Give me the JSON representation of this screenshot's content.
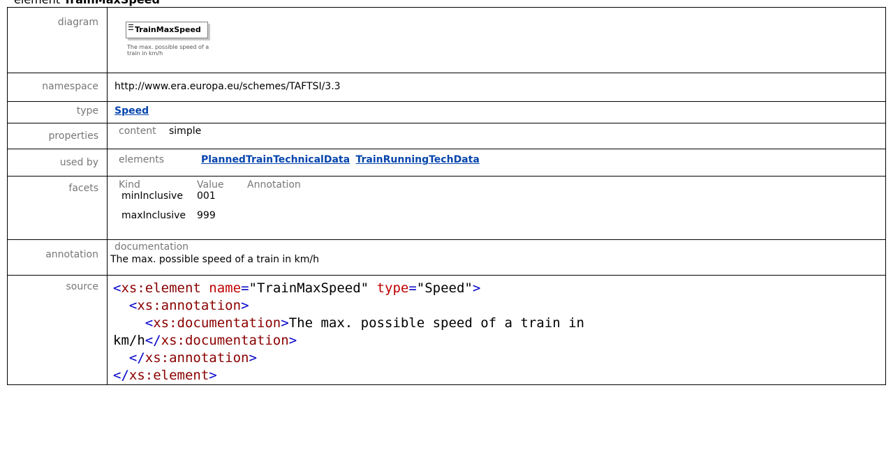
{
  "heading": {
    "keyword": "element",
    "name": "TrainMaxSpeed"
  },
  "rows": {
    "diagram": {
      "label": "diagram",
      "box_name": "TrainMaxSpeed",
      "box_doc": "The max. possible speed of a train in km/h"
    },
    "namespace": {
      "label": "namespace",
      "value": "http://www.era.europa.eu/schemes/TAFTSI/3.3"
    },
    "type": {
      "label": "type",
      "value": "Speed"
    },
    "properties": {
      "label": "properties",
      "key": "content",
      "value": "simple"
    },
    "used_by": {
      "label": "used by",
      "key": "elements",
      "links": [
        "PlannedTrainTechnicalData",
        "TrainRunningTechData"
      ]
    },
    "facets": {
      "label": "facets",
      "headers": [
        "Kind",
        "Value",
        "Annotation"
      ],
      "rows": [
        {
          "kind": "minInclusive",
          "value": "001"
        },
        {
          "kind": "maxInclusive",
          "value": "999"
        }
      ]
    },
    "annotation": {
      "label": "annotation",
      "key": "documentation",
      "text": "The max. possible speed of a train in km/h"
    },
    "source": {
      "label": "source",
      "lines": [
        "<xs:element name=\"TrainMaxSpeed\" type=\"Speed\">",
        "  <xs:annotation>",
        "    <xs:documentation>The max. possible speed of a train in",
        "km/h</xs:documentation>",
        "  </xs:annotation>",
        "</xs:element>"
      ]
    }
  },
  "colors": {
    "link": "#0645ad",
    "label_gray": "#777777",
    "xml_tag": "#0000c8",
    "xml_attr": "#c00000",
    "xml_element": "#8b0000"
  }
}
